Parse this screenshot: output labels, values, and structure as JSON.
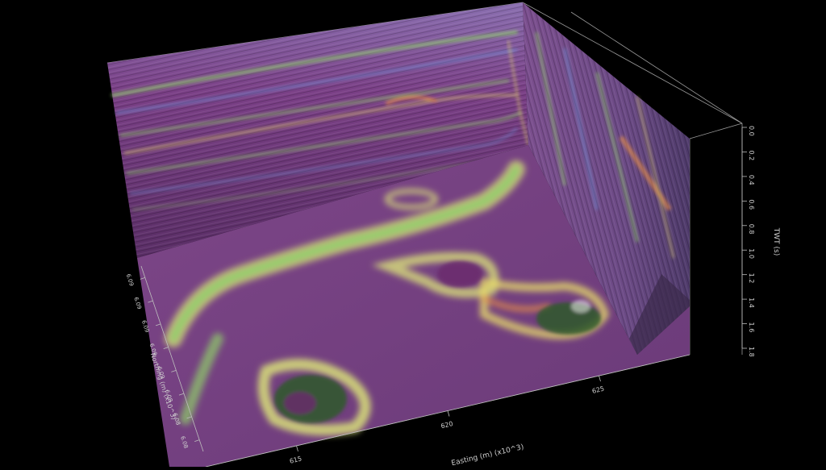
{
  "chart_data": {
    "type": "heatmap",
    "title": "",
    "colors": {
      "background": "#000000",
      "magenta": "#9a4fa0",
      "purple_dark": "#5d2f6a",
      "green": "#8fcf6a",
      "yellow": "#e6d96a",
      "blue": "#6e8fd6",
      "orange": "#e08a4a",
      "axis": "#bdbdbd"
    },
    "axes": {
      "easting": {
        "label": "Easting (m) (x10^3)",
        "ticks": [
          "615",
          "620",
          "625"
        ],
        "values": [
          615,
          620,
          625
        ],
        "range": [
          612,
          628
        ]
      },
      "northing": {
        "label": "Northing (m) (x10^3)",
        "ticks": [
          "6.09",
          "6.09",
          "6.09",
          "6.09",
          "6.09",
          "6.08",
          "6.08",
          "6.08"
        ],
        "range": [
          6.08,
          6.09
        ]
      },
      "twt": {
        "label": "TWT (s)",
        "ticks": [
          "0.0",
          "0.2",
          "0.4",
          "0.6",
          "0.8",
          "1.0",
          "1.2",
          "1.4",
          "1.6",
          "1.8"
        ],
        "values": [
          0.0,
          0.2,
          0.4,
          0.6,
          0.8,
          1.0,
          1.2,
          1.4,
          1.6,
          1.8
        ],
        "range": [
          0.0,
          1.8
        ]
      }
    }
  }
}
